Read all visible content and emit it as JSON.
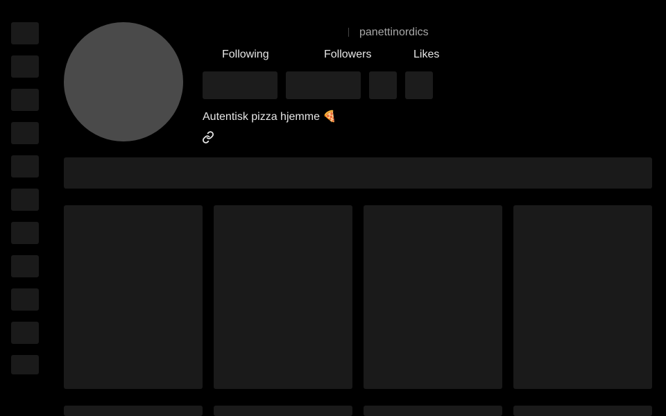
{
  "profile": {
    "username": "panettinordics",
    "bio": "Autentisk pizza hjemme 🍕"
  },
  "stats": {
    "following_label": "Following",
    "followers_label": "Followers",
    "likes_label": "Likes"
  },
  "icons": {
    "link": "link-icon"
  },
  "colors": {
    "background": "#000000",
    "skeleton": "#1a1a1a",
    "avatar_placeholder": "#4a4a4a",
    "text_primary": "#e6e6e6",
    "text_secondary": "#a8a8a8"
  }
}
